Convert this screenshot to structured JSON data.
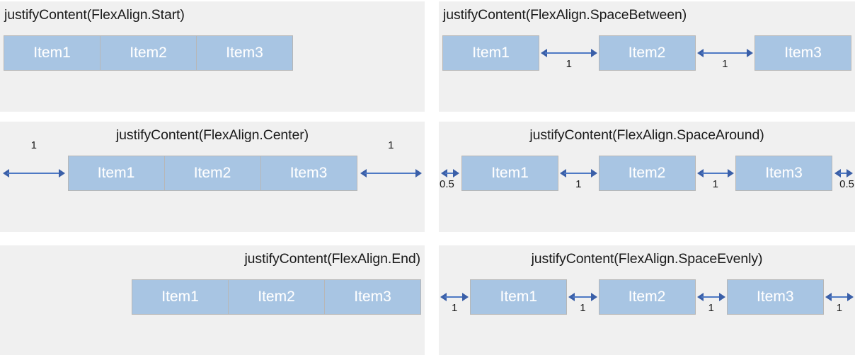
{
  "colors": {
    "panel_background": "#f0f0f0",
    "page_background": "#ffffff",
    "item_fill": "#a8c5e3",
    "item_border": "#b7b7b7",
    "item_text": "#ffffff",
    "arrow": "#4e79c4",
    "arrow_head": "#3a5fa8",
    "title_text": "#1a1a1a",
    "label_text": "#1a1a1a"
  },
  "items": {
    "item1": "Item1",
    "item2": "Item2",
    "item3": "Item3"
  },
  "panels": [
    {
      "id": "start",
      "title": "justifyContent(FlexAlign.Start)",
      "title_align": "left",
      "mode": "start",
      "gaps": []
    },
    {
      "id": "space-between",
      "title": "justifyContent(FlexAlign.SpaceBetween)",
      "title_align": "left",
      "mode": "space-between",
      "gaps": [
        {
          "position": "between-1-2",
          "label": "1"
        },
        {
          "position": "between-2-3",
          "label": "1"
        }
      ]
    },
    {
      "id": "center",
      "title": "justifyContent(FlexAlign.Center)",
      "title_align": "center",
      "mode": "center",
      "gaps": [
        {
          "position": "leading",
          "label": "1"
        },
        {
          "position": "trailing",
          "label": "1"
        }
      ]
    },
    {
      "id": "space-around",
      "title": "justifyContent(FlexAlign.SpaceAround)",
      "title_align": "center",
      "mode": "space-around",
      "gaps": [
        {
          "position": "leading",
          "label": "0.5"
        },
        {
          "position": "between-1-2",
          "label": "1"
        },
        {
          "position": "between-2-3",
          "label": "1"
        },
        {
          "position": "trailing",
          "label": "0.5"
        }
      ]
    },
    {
      "id": "end",
      "title": "justifyContent(FlexAlign.End)",
      "title_align": "right",
      "mode": "end",
      "gaps": []
    },
    {
      "id": "space-evenly",
      "title": "justifyContent(FlexAlign.SpaceEvenly)",
      "title_align": "center",
      "mode": "space-evenly",
      "gaps": [
        {
          "position": "leading",
          "label": "1"
        },
        {
          "position": "between-1-2",
          "label": "1"
        },
        {
          "position": "between-2-3",
          "label": "1"
        },
        {
          "position": "trailing",
          "label": "1"
        }
      ]
    }
  ]
}
